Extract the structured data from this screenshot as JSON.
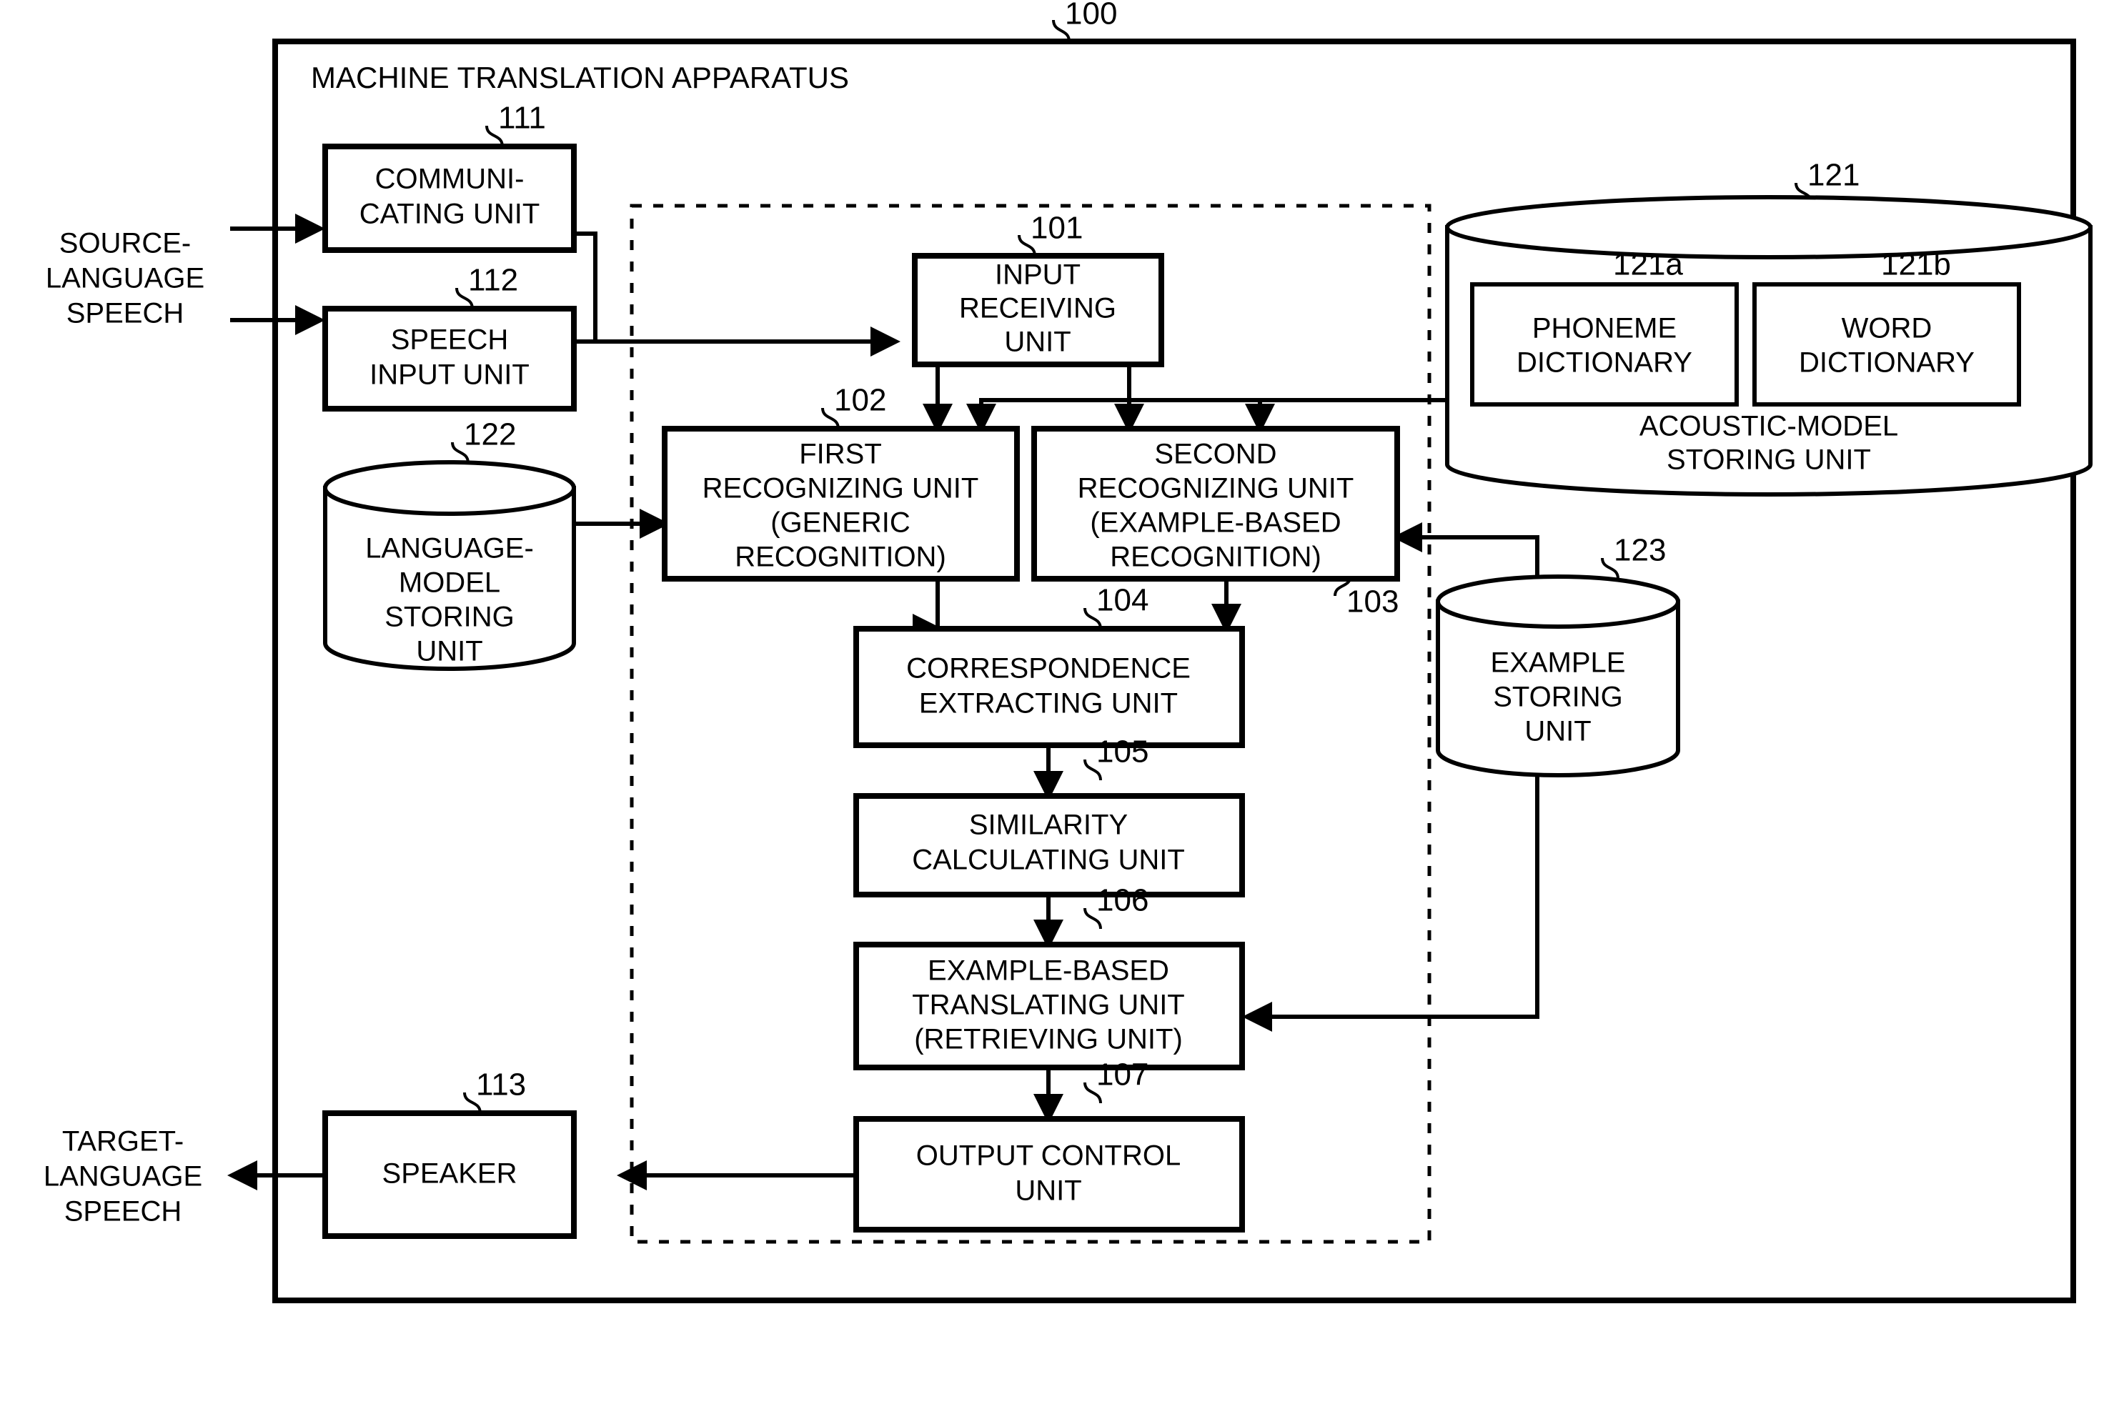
{
  "figure": {
    "title": "MACHINE TRANSLATION APPARATUS",
    "apparatus_ref": "100"
  },
  "io_labels": {
    "source": "SOURCE-\nLANGUAGE\nSPEECH",
    "source_l1": "SOURCE-",
    "source_l2": "LANGUAGE",
    "source_l3": "SPEECH",
    "target_l1": "TARGET-",
    "target_l2": "LANGUAGE",
    "target_l3": "SPEECH"
  },
  "blocks": [
    {
      "ref": "111",
      "lines": [
        "COMMUNI-",
        "CATING UNIT"
      ]
    },
    {
      "ref": "112",
      "lines": [
        "SPEECH",
        "INPUT UNIT"
      ]
    },
    {
      "ref": "101",
      "lines": [
        "INPUT",
        "RECEIVING",
        "UNIT"
      ]
    },
    {
      "ref": "102",
      "lines": [
        "FIRST",
        "RECOGNIZING UNIT",
        "(GENERIC",
        "RECOGNITION)"
      ]
    },
    {
      "ref": "103",
      "lines": [
        "SECOND",
        "RECOGNIZING UNIT",
        "(EXAMPLE-BASED",
        "RECOGNITION)"
      ]
    },
    {
      "ref": "104",
      "lines": [
        "CORRESPONDENCE",
        "EXTRACTING UNIT"
      ]
    },
    {
      "ref": "105",
      "lines": [
        "SIMILARITY",
        "CALCULATING UNIT"
      ]
    },
    {
      "ref": "106",
      "lines": [
        "EXAMPLE-BASED",
        "TRANSLATING UNIT",
        "(RETRIEVING UNIT)"
      ]
    },
    {
      "ref": "107",
      "lines": [
        "OUTPUT CONTROL",
        "UNIT"
      ]
    },
    {
      "ref": "113",
      "lines": [
        "SPEAKER"
      ]
    }
  ],
  "stores": [
    {
      "ref": "121",
      "lines": [
        "ACOUSTIC-MODEL",
        "STORING UNIT"
      ]
    },
    {
      "ref": "122",
      "lines": [
        "LANGUAGE-",
        "MODEL",
        "STORING",
        "UNIT"
      ]
    },
    {
      "ref": "123",
      "lines": [
        "EXAMPLE",
        "STORING",
        "UNIT"
      ]
    }
  ],
  "dictionaries": [
    {
      "ref": "121a",
      "lines": [
        "PHONEME",
        "DICTIONARY"
      ]
    },
    {
      "ref": "121b",
      "lines": [
        "WORD",
        "DICTIONARY"
      ]
    }
  ],
  "text": {
    "communicating_l1": "COMMUNI-",
    "communicating_l2": "CATING UNIT",
    "speech_input_l1": "SPEECH",
    "speech_input_l2": "INPUT UNIT",
    "input_receiving_l1": "INPUT",
    "input_receiving_l2": "RECEIVING",
    "input_receiving_l3": "UNIT",
    "first_rec_l1": "FIRST",
    "first_rec_l2": "RECOGNIZING UNIT",
    "first_rec_l3": "(GENERIC",
    "first_rec_l4": "RECOGNITION)",
    "second_rec_l1": "SECOND",
    "second_rec_l2": "RECOGNIZING UNIT",
    "second_rec_l3": "(EXAMPLE-BASED",
    "second_rec_l4": "RECOGNITION)",
    "corr_l1": "CORRESPONDENCE",
    "corr_l2": "EXTRACTING UNIT",
    "sim_l1": "SIMILARITY",
    "sim_l2": "CALCULATING UNIT",
    "ebt_l1": "EXAMPLE-BASED",
    "ebt_l2": "TRANSLATING UNIT",
    "ebt_l3": "(RETRIEVING UNIT)",
    "out_l1": "OUTPUT CONTROL",
    "out_l2": "UNIT",
    "speaker_l1": "SPEAKER",
    "acoustic_l1": "ACOUSTIC-MODEL",
    "acoustic_l2": "STORING UNIT",
    "lang_l1": "LANGUAGE-",
    "lang_l2": "MODEL",
    "lang_l3": "STORING",
    "lang_l4": "UNIT",
    "example_l1": "EXAMPLE",
    "example_l2": "STORING",
    "example_l3": "UNIT",
    "phoneme_l1": "PHONEME",
    "phoneme_l2": "DICTIONARY",
    "word_l1": "WORD",
    "word_l2": "DICTIONARY"
  },
  "refs": {
    "r100": "100",
    "r101": "101",
    "r102": "102",
    "r103": "103",
    "r104": "104",
    "r105": "105",
    "r106": "106",
    "r107": "107",
    "r111": "111",
    "r112": "112",
    "r113": "113",
    "r121": "121",
    "r121a": "121a",
    "r121b": "121b",
    "r122": "122",
    "r123": "123"
  },
  "colors": {
    "ink": "#000000",
    "paper": "#ffffff"
  }
}
